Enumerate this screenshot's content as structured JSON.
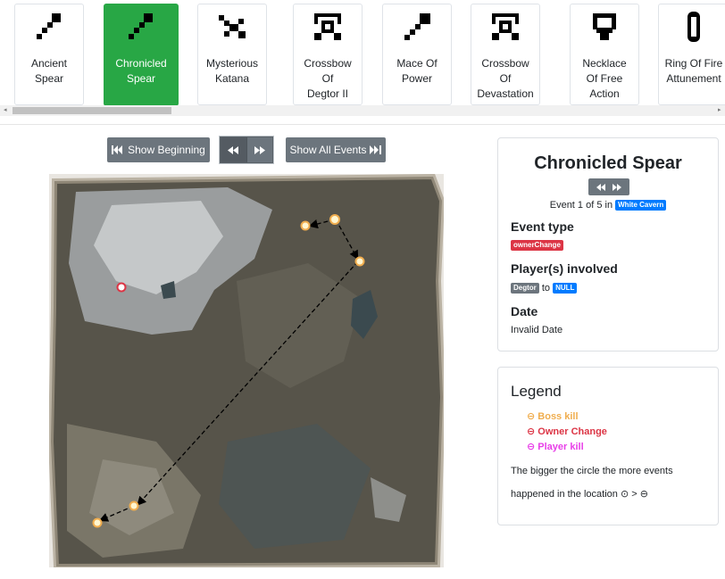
{
  "items": [
    {
      "label_lines": [
        "Ancient",
        "Spear"
      ],
      "icon": "spear-icon",
      "active": false
    },
    {
      "label_lines": [
        "Chronicled",
        "Spear"
      ],
      "icon": "spear-icon",
      "active": true
    },
    {
      "label_lines": [
        "Mysterious",
        "Katana"
      ],
      "icon": "katana-icon",
      "active": false
    },
    {
      "label_lines": [
        "Crossbow",
        "Of",
        "Degtor II"
      ],
      "icon": "crossbow-icon",
      "active": false
    },
    {
      "label_lines": [
        "Mace Of",
        "Power"
      ],
      "icon": "mace-icon",
      "active": false
    },
    {
      "label_lines": [
        "Crossbow",
        "Of",
        "Devastation"
      ],
      "icon": "crossbow-icon",
      "active": false
    },
    {
      "label_lines": [
        "Necklace",
        "Of Free",
        "Action"
      ],
      "icon": "necklace-icon",
      "active": false
    },
    {
      "label_lines": [
        "Ring Of Fire",
        "Attunement"
      ],
      "icon": "ring-icon",
      "active": false
    }
  ],
  "controls": {
    "show_beginning": "Show Beginning",
    "show_all_events": "Show All Events",
    "rewind_icon": "rewind-icon",
    "forward_icon": "fast-forward-icon"
  },
  "info": {
    "title": "Chronicled Spear",
    "event_prefix": "Event 1 of 5 in",
    "location": "White Cavern",
    "event_type_label": "Event type",
    "event_type": "ownerChange",
    "players_label": "Player(s) involved",
    "player_from": "Degtor",
    "player_to_word": "to",
    "player_to": "NULL",
    "date_label": "Date",
    "date": "Invalid Date"
  },
  "legend": {
    "title": "Legend",
    "items": [
      {
        "symbol": "⊖",
        "label": "Boss kill",
        "color": "#f0ad4e"
      },
      {
        "symbol": "⊖",
        "label": "Owner Change",
        "color": "#dc3545"
      },
      {
        "symbol": "⊖",
        "label": "Player kill",
        "color": "#e83ee8"
      }
    ],
    "note_line1": "The bigger the circle the more events",
    "note_line2": "happened in the location",
    "note_symbols": "⊙ > ⊖"
  },
  "colors": {
    "active_item": "#28a745",
    "button": "#6c757d",
    "badge_blue": "#007bff",
    "badge_red": "#dc3545",
    "marker_boss": "#f0ad4e",
    "marker_owner": "#dc3545"
  }
}
